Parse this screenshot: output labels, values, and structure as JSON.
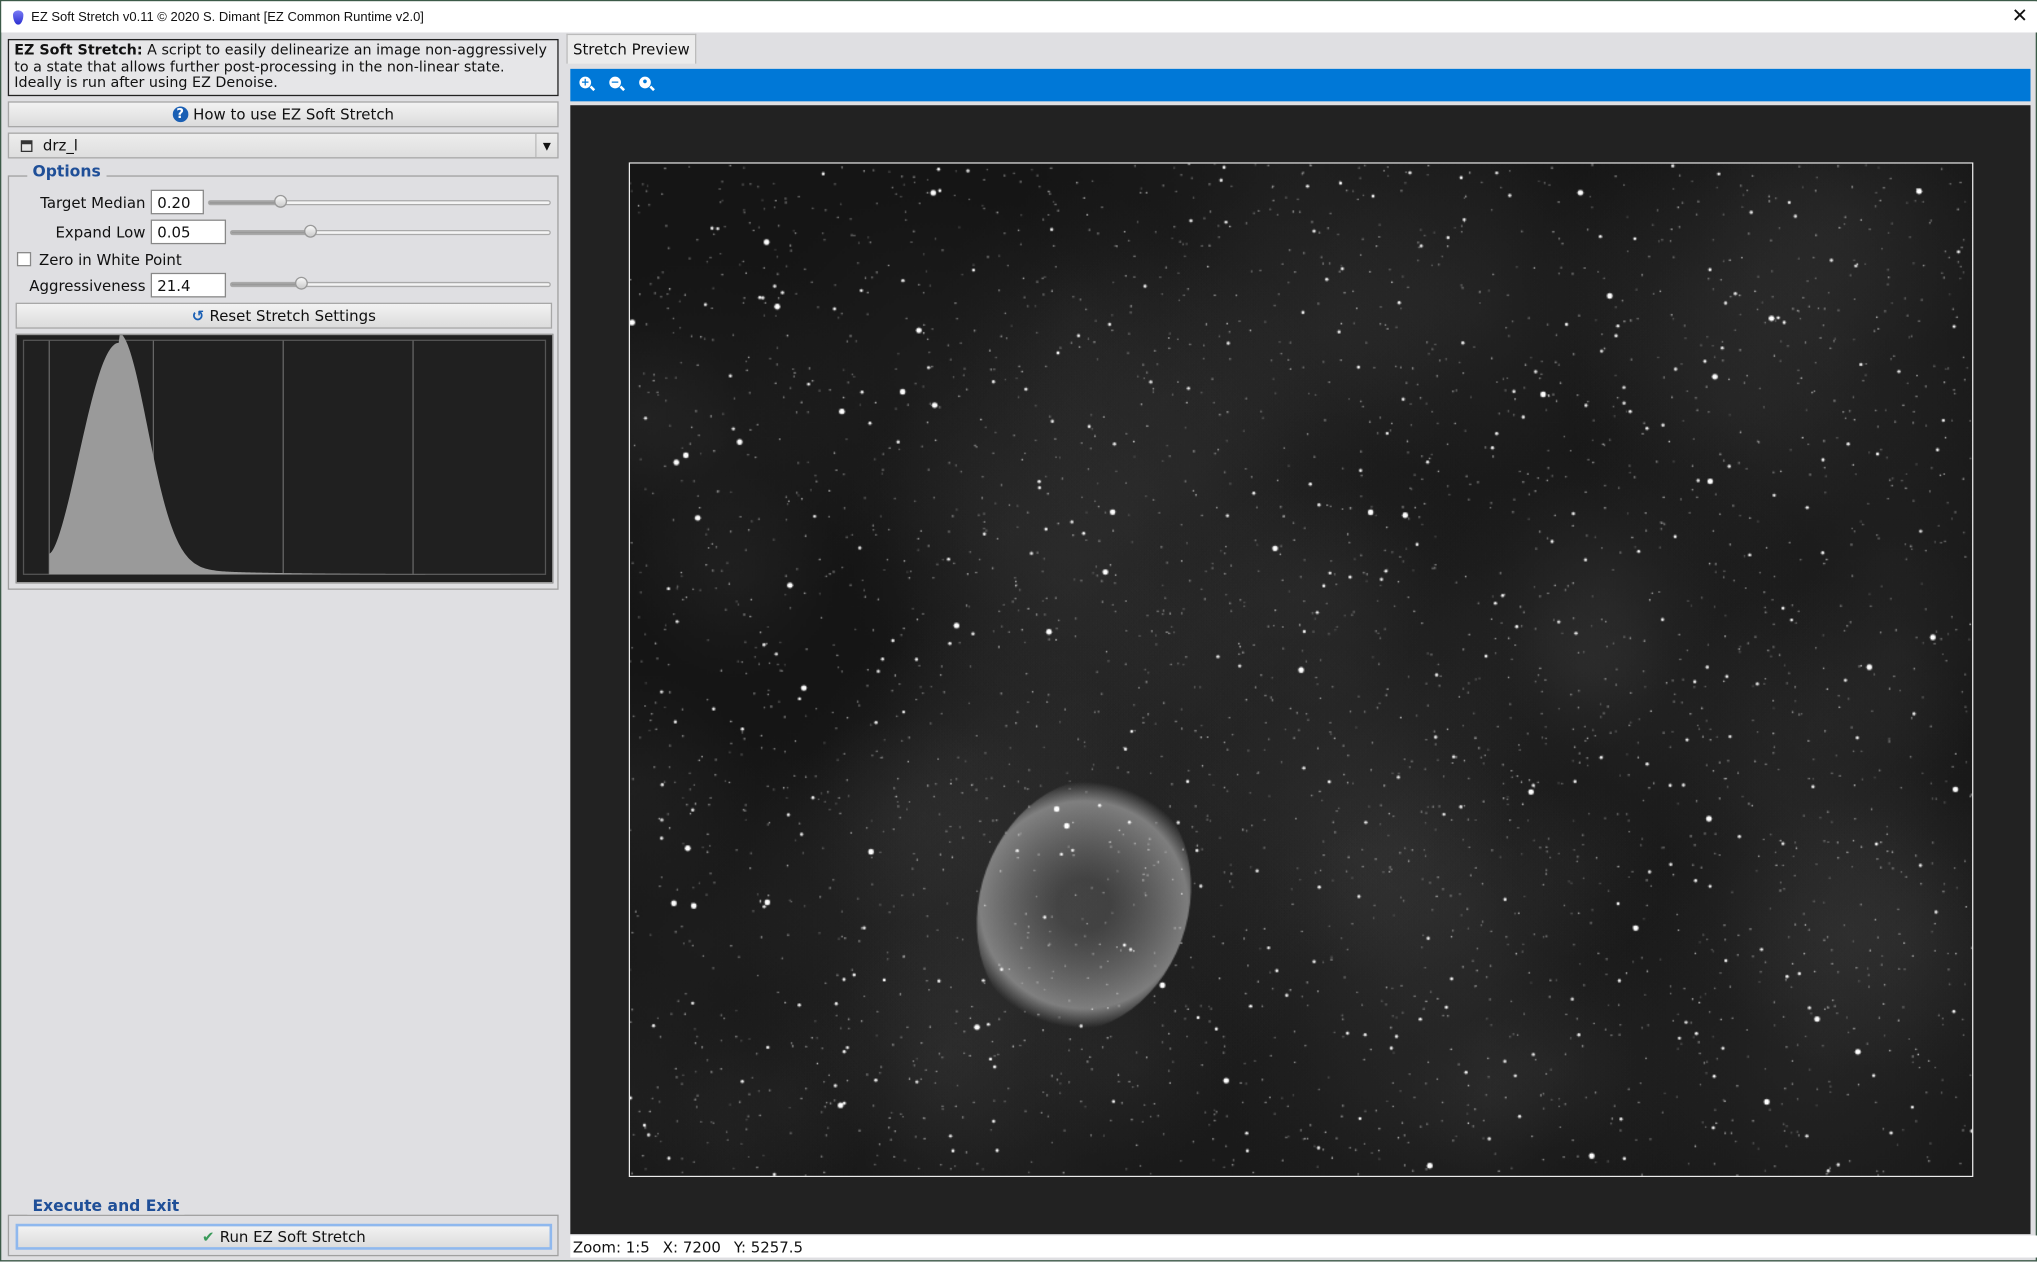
{
  "window": {
    "title": "EZ Soft Stretch v0.11 © 2020 S. Dimant [EZ Common Runtime v2.0]",
    "close": "✕"
  },
  "description": {
    "bold": "EZ Soft Stretch:",
    "text": " A script to easily delinearize an image non-aggressively to a state that allows further post-processing in the non-linear state. Ideally is run after using EZ Denoise."
  },
  "help_button": "How to use EZ Soft Stretch",
  "image_select": {
    "value": "drz_l"
  },
  "options": {
    "title": "Options",
    "target_median": {
      "label": "Target Median",
      "value": "0.20",
      "slider_level": 0.21
    },
    "expand_low": {
      "label": "Expand Low",
      "value": "0.05",
      "slider_level": 0.25
    },
    "zero_white": {
      "label": "Zero in White Point",
      "checked": false
    },
    "aggressiveness": {
      "label": "Aggressiveness",
      "value": "21.4",
      "slider_level": 0.22
    },
    "reset_button": "Reset Stretch Settings"
  },
  "execute": {
    "title": "Execute and Exit",
    "run_button": "Run EZ Soft Stretch"
  },
  "preview": {
    "tab": "Stretch Preview",
    "toolbar": [
      "zoom-in-icon",
      "zoom-out-icon",
      "zoom-fit-icon"
    ],
    "status": {
      "zoom": "Zoom: 1:5",
      "x": "X: 7200",
      "y": "Y: 5257.5"
    }
  },
  "colors": {
    "accent": "#0078d7",
    "group_title": "#1f4f98",
    "viewer_bg": "#222222"
  }
}
